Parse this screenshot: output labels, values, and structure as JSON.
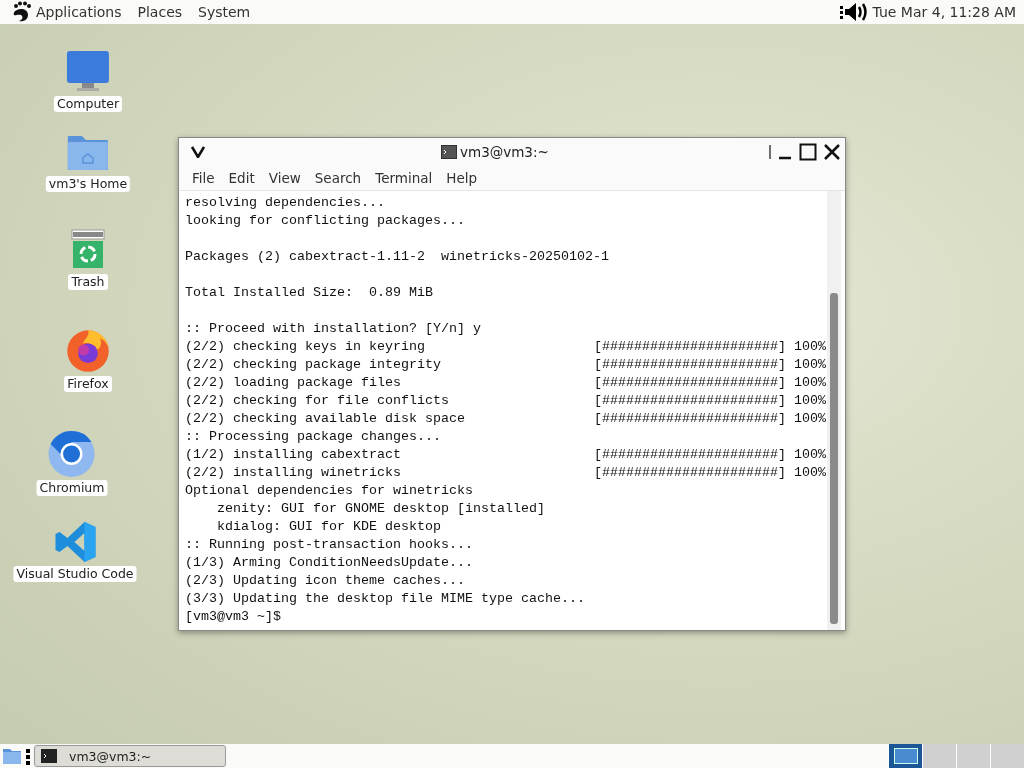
{
  "top_panel": {
    "menus": [
      "Applications",
      "Places",
      "System"
    ],
    "clock": "Tue Mar  4, 11:28 AM"
  },
  "desktop_icons": [
    {
      "kind": "computer",
      "label": "Computer"
    },
    {
      "kind": "home",
      "label": "vm3's Home"
    },
    {
      "kind": "trash",
      "label": "Trash"
    },
    {
      "kind": "firefox",
      "label": "Firefox"
    },
    {
      "kind": "chromium",
      "label": "Chromium"
    },
    {
      "kind": "vscode",
      "label": "Visual Studio Code"
    }
  ],
  "window": {
    "title": "vm3@vm3:~",
    "menu": [
      "File",
      "Edit",
      "View",
      "Search",
      "Terminal",
      "Help"
    ],
    "lines": [
      {
        "kind": "text",
        "text": "resolving dependencies..."
      },
      {
        "kind": "text",
        "text": "looking for conflicting packages..."
      },
      {
        "kind": "blank"
      },
      {
        "kind": "text",
        "text": "Packages (2) cabextract-1.11-2  winetricks-20250102-1"
      },
      {
        "kind": "blank"
      },
      {
        "kind": "text",
        "text": "Total Installed Size:  0.89 MiB"
      },
      {
        "kind": "blank"
      },
      {
        "kind": "text",
        "text": ":: Proceed with installation? [Y/n] y"
      },
      {
        "kind": "progress",
        "text": "(2/2) checking keys in keyring",
        "bar": "[######################]",
        "percent": "100%"
      },
      {
        "kind": "progress",
        "text": "(2/2) checking package integrity",
        "bar": "[######################]",
        "percent": "100%"
      },
      {
        "kind": "progress",
        "text": "(2/2) loading package files",
        "bar": "[######################]",
        "percent": "100%"
      },
      {
        "kind": "progress",
        "text": "(2/2) checking for file conflicts",
        "bar": "[######################]",
        "percent": "100%"
      },
      {
        "kind": "progress",
        "text": "(2/2) checking available disk space",
        "bar": "[######################]",
        "percent": "100%"
      },
      {
        "kind": "text",
        "text": ":: Processing package changes..."
      },
      {
        "kind": "progress",
        "text": "(1/2) installing cabextract",
        "bar": "[######################]",
        "percent": "100%"
      },
      {
        "kind": "progress",
        "text": "(2/2) installing winetricks",
        "bar": "[######################]",
        "percent": "100%"
      },
      {
        "kind": "text",
        "text": "Optional dependencies for winetricks"
      },
      {
        "kind": "text",
        "text": "    zenity: GUI for GNOME desktop [installed]"
      },
      {
        "kind": "text",
        "text": "    kdialog: GUI for KDE desktop"
      },
      {
        "kind": "text",
        "text": ":: Running post-transaction hooks..."
      },
      {
        "kind": "text",
        "text": "(1/3) Arming ConditionNeedsUpdate..."
      },
      {
        "kind": "text",
        "text": "(2/3) Updating icon theme caches..."
      },
      {
        "kind": "text",
        "text": "(3/3) Updating the desktop file MIME type cache..."
      },
      {
        "kind": "text",
        "text": "[vm3@vm3 ~]$"
      }
    ]
  },
  "bottom_panel": {
    "tasks": [
      {
        "title": "vm3@vm3:~",
        "selected": false
      }
    ],
    "workspaces": [
      {
        "selected": true
      },
      {
        "selected": false
      },
      {
        "selected": false
      },
      {
        "selected": false
      }
    ]
  }
}
